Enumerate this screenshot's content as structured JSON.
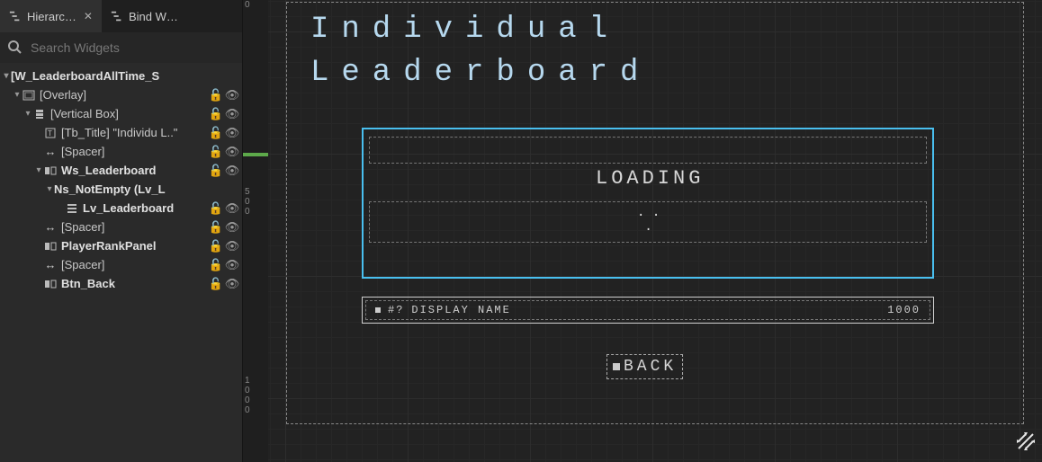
{
  "tabs": {
    "hierarchy": "Hierarc…",
    "bind": "Bind W…"
  },
  "search": {
    "placeholder": "Search Widgets"
  },
  "tree": {
    "root": "[W_LeaderboardAllTime_S",
    "overlay": "[Overlay]",
    "vbox": "[Vertical Box]",
    "title": "[Tb_Title] \"Individu L..\"",
    "spacer": "[Spacer]",
    "ws": "Ws_Leaderboard",
    "ns": "Ns_NotEmpty (Lv_L",
    "lv": "Lv_Leaderboard",
    "rankpanel": "PlayerRankPanel",
    "back": "Btn_Back"
  },
  "canvas": {
    "title_line1": "Individual",
    "title_line2": "Leaderboard",
    "loading": "LOADING",
    "rank": "#?",
    "display_name": "DISPLAY NAME",
    "score": "1000",
    "back": "BACK"
  },
  "ruler": {
    "tick0": "0",
    "tick500_a": "5",
    "tick500_b": "0",
    "tick500_c": "0",
    "tick1000_a": "1",
    "tick1000_b": "0",
    "tick1000_c": "0",
    "tick1000_d": "0"
  }
}
